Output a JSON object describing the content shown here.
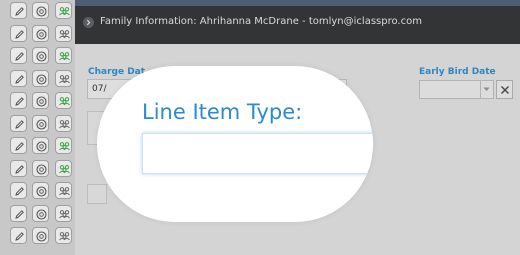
{
  "header": {
    "title": "Family Information: Ahrihanna McDrane - tomlyn@iclasspro.com"
  },
  "form": {
    "charge_date_label": "Charge Dat",
    "charge_date_value": "07/",
    "early_bird_label": "Early Bird Date",
    "early_bird_value": ""
  },
  "magnifier": {
    "line_item_type_label": "Line Item Type:",
    "line_item_type_value": ""
  },
  "row_actions": [
    {
      "edit": "pencil-icon",
      "view": "circle-icon",
      "family": "people-icon",
      "family_active": true
    },
    {
      "edit": "pencil-icon",
      "view": "circle-icon",
      "family": "people-icon",
      "family_active": false
    },
    {
      "edit": "pencil-icon",
      "view": "circle-icon",
      "family": "people-icon",
      "family_active": true
    },
    {
      "edit": "pencil-icon",
      "view": "circle-icon",
      "family": "people-icon",
      "family_active": false
    },
    {
      "edit": "pencil-icon",
      "view": "circle-icon",
      "family": "people-icon",
      "family_active": true
    },
    {
      "edit": "pencil-icon",
      "view": "circle-icon",
      "family": "people-icon",
      "family_active": false
    },
    {
      "edit": "pencil-icon",
      "view": "circle-icon",
      "family": "people-icon",
      "family_active": true
    },
    {
      "edit": "pencil-icon",
      "view": "circle-icon",
      "family": "people-icon",
      "family_active": true
    },
    {
      "edit": "pencil-icon",
      "view": "circle-icon",
      "family": "people-icon",
      "family_active": false
    },
    {
      "edit": "pencil-icon",
      "view": "circle-icon",
      "family": "people-icon",
      "family_active": false
    },
    {
      "edit": "pencil-icon",
      "view": "circle-icon",
      "family": "people-icon",
      "family_active": false
    }
  ],
  "colors": {
    "accent_blue": "#2e87c0",
    "magnifier_blue": "#2b8bd0",
    "header_bg": "#333436",
    "active_green": "#3fa34d",
    "inactive_gray": "#6a6a6a"
  }
}
